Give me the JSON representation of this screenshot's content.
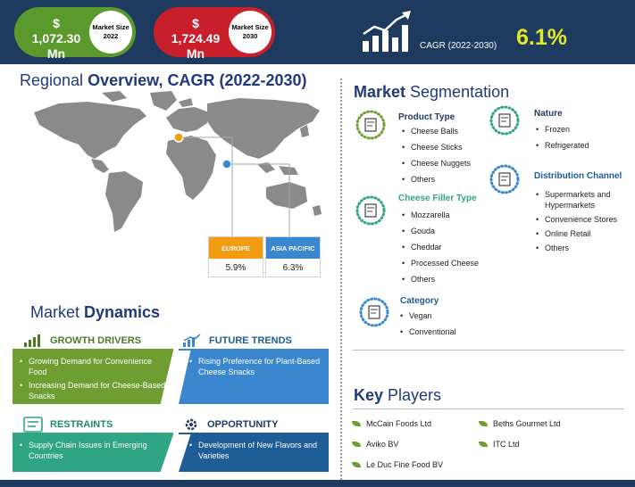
{
  "banner": {
    "market_size_2022": {
      "value": "$ 1,072.30 Mn",
      "label": "Market Size 2022"
    },
    "market_size_2030": {
      "value": "$ 1,724.49 Mn",
      "label": "Market Size 2030"
    },
    "cagr_label": "CAGR (2022-2030)",
    "cagr_value": "6.1%"
  },
  "regional": {
    "title_a": "Regional ",
    "title_b": "Overview, CAGR (2022-2030)",
    "regions": [
      {
        "name": "EUROPE",
        "value": "5.9%",
        "color": "#f39c12"
      },
      {
        "name": "ASIA PACIFIC",
        "value": "6.3%",
        "color": "#3a87cf"
      }
    ]
  },
  "dynamics": {
    "title_a": "Market ",
    "title_b": "Dynamics",
    "growth_drivers": {
      "title": "GROWTH DRIVERS",
      "items": [
        "Growing Demand for Convenience Food",
        "Increasing Demand for Cheese-Based Snacks"
      ]
    },
    "future_trends": {
      "title": "FUTURE TRENDS",
      "items": [
        "Rising Preference for Plant-Based Cheese Snacks"
      ]
    },
    "restraints": {
      "title": "RESTRAINTS",
      "items": [
        "Supply Chain Issues in Emerging Countries"
      ]
    },
    "opportunity": {
      "title": "OPPORTUNITY",
      "items": [
        "Development of New Flavors and Varieties"
      ]
    }
  },
  "segmentation": {
    "title_a": "Market ",
    "title_b": "Segmentation",
    "product_type": {
      "title": "Product Type",
      "items": [
        "Cheese Balls",
        "Cheese Sticks",
        "Cheese Nuggets",
        "Others"
      ]
    },
    "cheese_filler_type": {
      "title": "Cheese Filler Type",
      "items": [
        "Mozzarella",
        "Gouda",
        "Cheddar",
        "Processed Cheese",
        "Others"
      ]
    },
    "category": {
      "title": "Category",
      "items": [
        "Vegan",
        "Conventional"
      ]
    },
    "nature": {
      "title": "Nature",
      "items": [
        "Frozen",
        "Refrigerated"
      ]
    },
    "distribution_channel": {
      "title": "Distribution Channel",
      "items": [
        "Supermarkets and Hypermarkets",
        "Convenience Stores",
        "Online Retail",
        "Others"
      ]
    }
  },
  "key_players": {
    "title_a": "Key ",
    "title_b": "Players",
    "items": [
      "McCain Foods Ltd",
      "Beths Gourmet Ltd",
      "Aviko BV",
      "ITC Ltd",
      "Le Duc Fine Food BV"
    ]
  },
  "colors": {
    "navy": "#1f3a5f",
    "green": "#6e9e32",
    "red": "#c81f2b",
    "blue": "#3a87cf",
    "teal": "#2fa584",
    "accent_yellow": "#e3e829"
  }
}
